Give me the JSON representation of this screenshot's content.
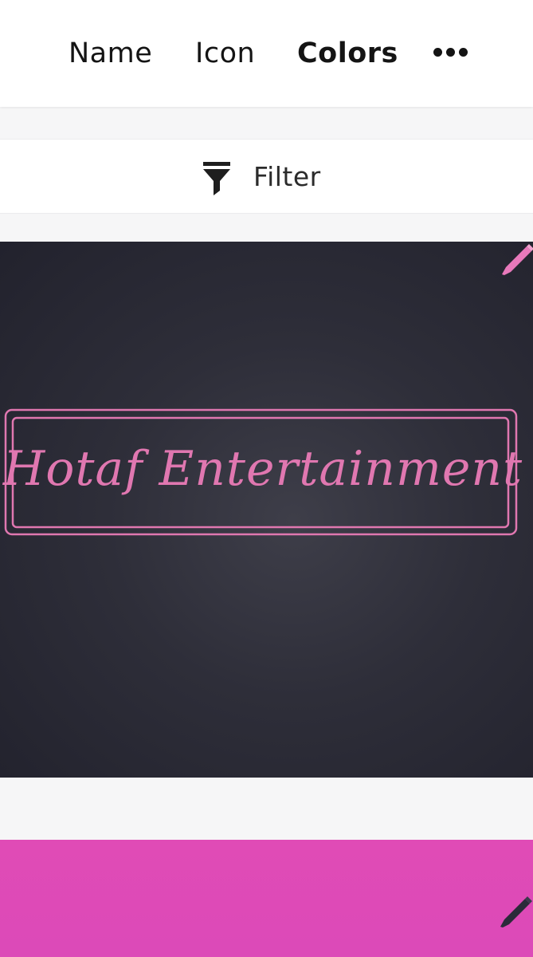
{
  "tabs": {
    "name_label": "Name",
    "icon_label": "Icon",
    "colors_label": "Colors",
    "more_icon": "more-horizontal-icon",
    "active": "Colors"
  },
  "filter": {
    "label": "Filter",
    "icon": "filter-funnel-icon"
  },
  "cards": [
    {
      "logo_text": "Hotaf Entertainment",
      "background_color": "#2a2a35",
      "accent_color": "#e077b0",
      "edit_icon": "pencil-icon"
    },
    {
      "background_color": "#de4ab7",
      "edit_icon": "pencil-icon"
    }
  ]
}
